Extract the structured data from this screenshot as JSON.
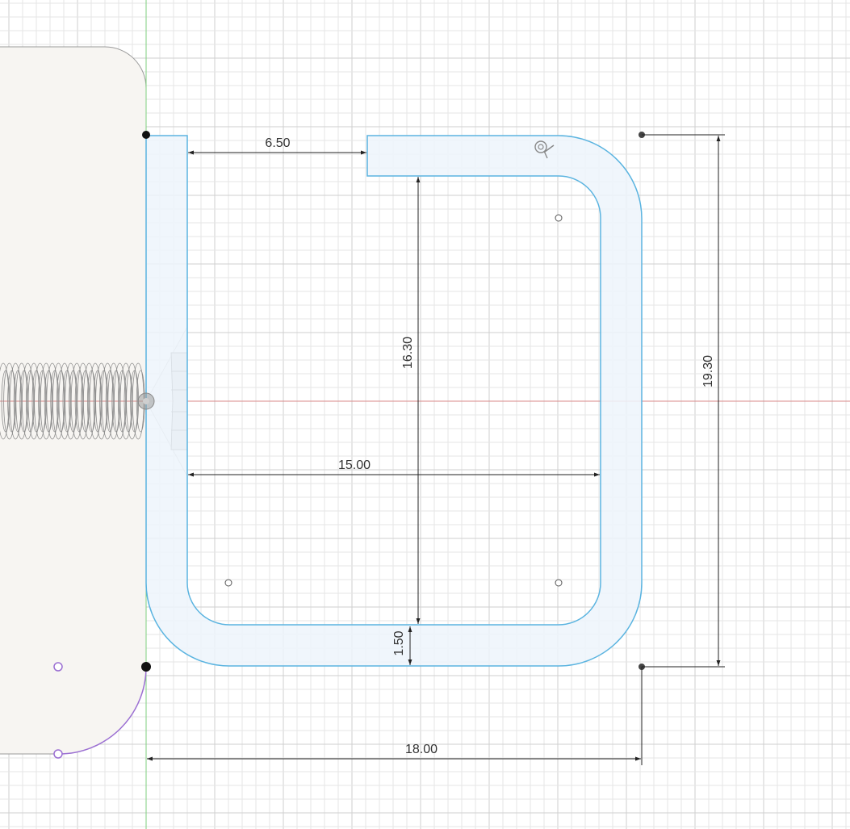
{
  "sketch": {
    "dimensions": {
      "gap_width": "6.50",
      "inner_height": "16.30",
      "inner_width": "15.00",
      "wall_thickness": "1.50",
      "outer_width": "18.00",
      "outer_height": "19.30"
    }
  },
  "colors": {
    "background": "#ffffff",
    "grid_minor": "#e6e6e6",
    "grid_major": "#cfcfcf",
    "x_axis": "#d98a8a",
    "y_axis": "#7fcf7f",
    "profile_fill": "#edf5fb",
    "profile_stroke": "#5bb4e0",
    "body_fill": "#f7f5f2",
    "body_stroke": "#9a9a9a",
    "dimension_line": "#222222",
    "constraint_point": "#111111",
    "selection_arc": "#9b6fd2"
  },
  "icons": {
    "origin": "origin-icon",
    "constraint": "fix-constraint-icon"
  }
}
